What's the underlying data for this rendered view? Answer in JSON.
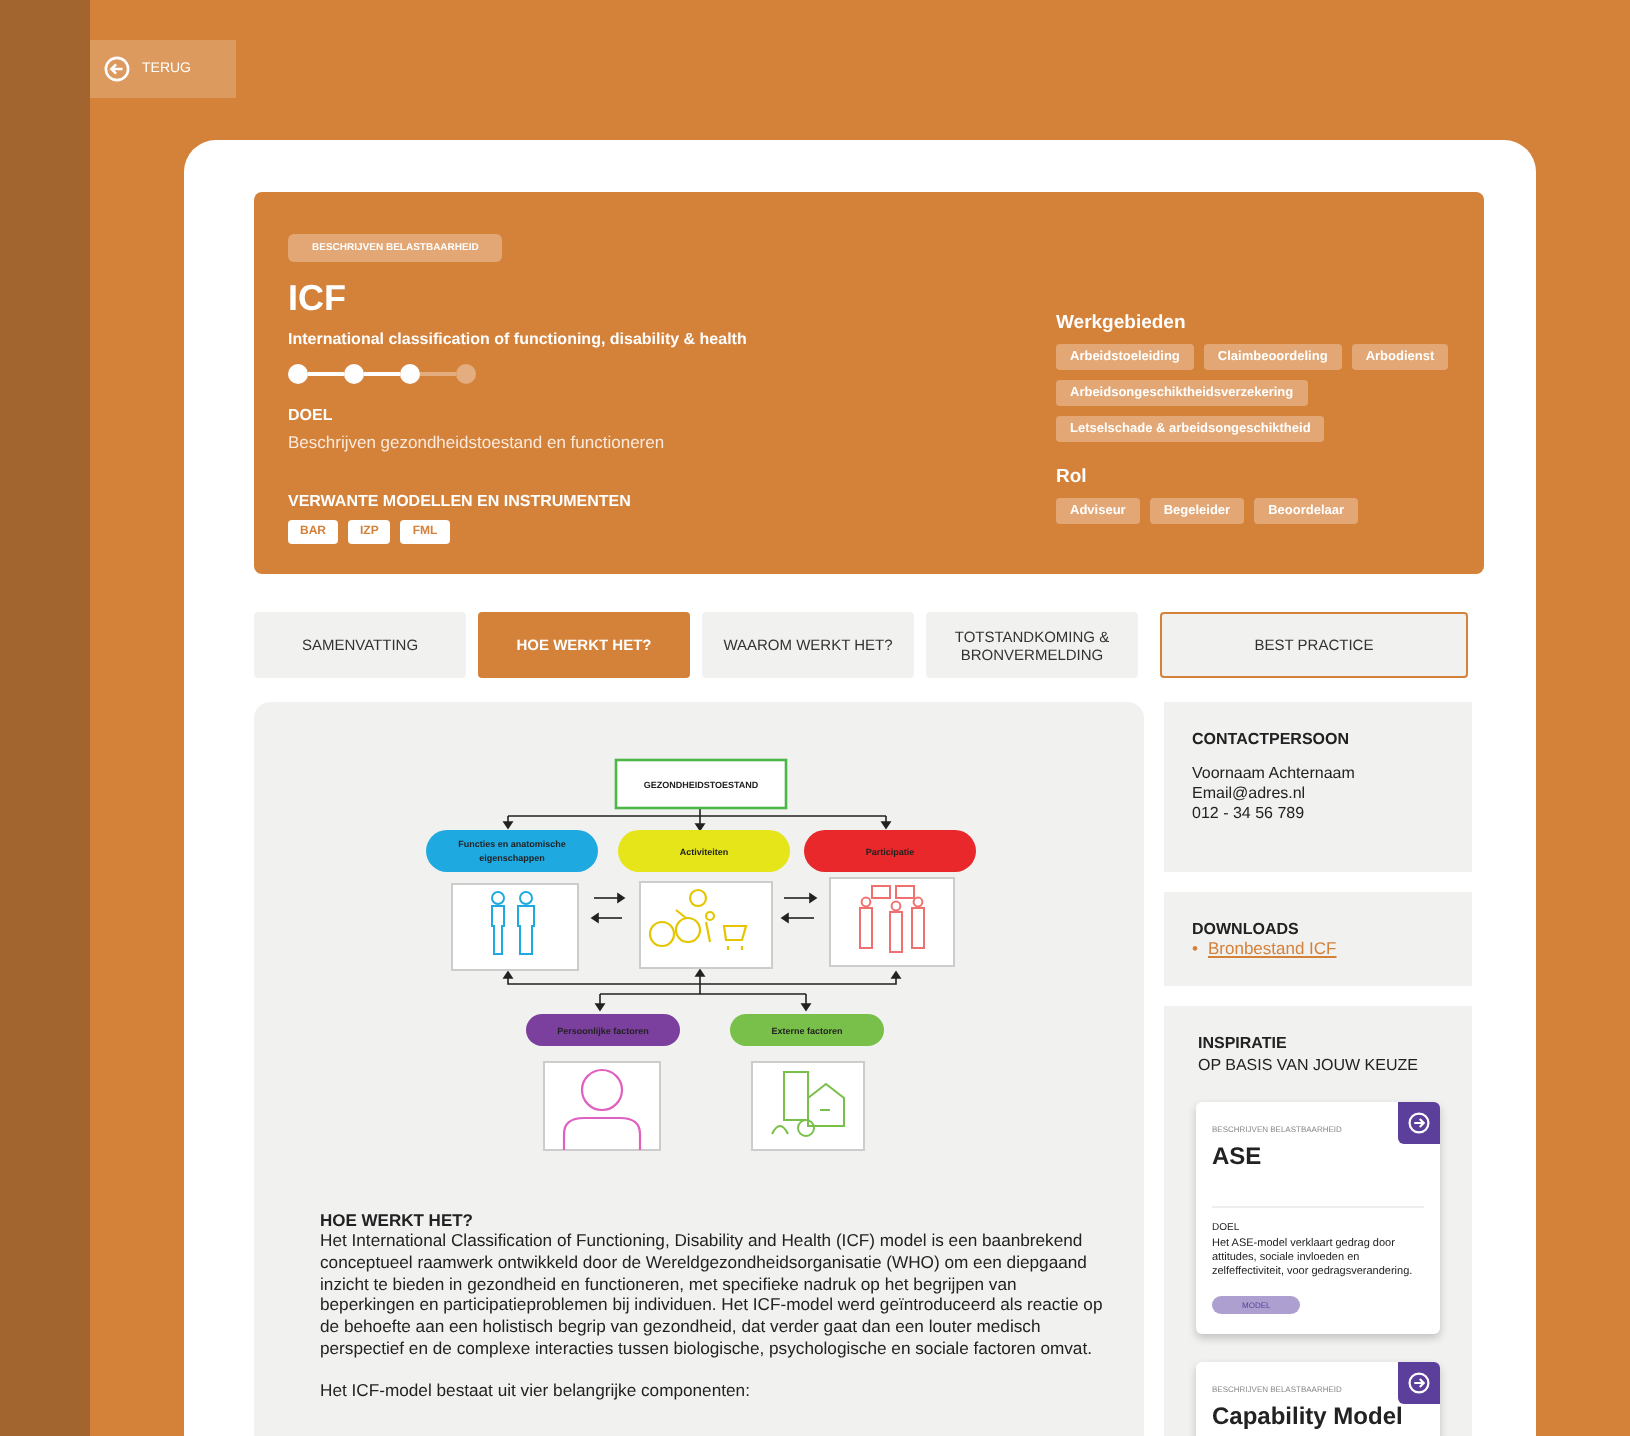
{
  "back_button": {
    "label": "TERUG"
  },
  "header": {
    "category": "BESCHRIJVEN BELASTBAARHEID",
    "title": "ICF",
    "subtitle": "International classification of functioning, disability & health",
    "steps": [
      {
        "on": true
      },
      {
        "on": true
      },
      {
        "on": true
      },
      {
        "on": false
      }
    ],
    "goal_label": "DOEL",
    "goal": "Beschrijven gezondheidstoestand en functioneren",
    "related_label": "VERWANTE MODELLEN EN INSTRUMENTEN",
    "related": [
      "BAR",
      "IZP",
      "FML"
    ],
    "areas_label": "Werkgebieden",
    "areas": [
      "Arbeidstoeleiding",
      "Claimbeoordeling",
      "Arbodienst",
      "Arbeidsongeschiktheidsverzekering",
      "Letselschade & arbeidsongeschiktheid"
    ],
    "role_label": "Rol",
    "roles": [
      "Adviseur",
      "Begeleider",
      "Beoordelaar"
    ]
  },
  "tabs": [
    {
      "label": "SAMENVATTING",
      "selected": false,
      "kind": "tab"
    },
    {
      "label": "HOE WERKT HET?",
      "selected": true,
      "kind": "tab"
    },
    {
      "label": "WAAROM WERKT HET?",
      "selected": false,
      "kind": "tab"
    },
    {
      "label": "TOTSTANDKOMING & BRONVERMELDING",
      "selected": false,
      "kind": "tab"
    },
    {
      "label": "BEST PRACTICE",
      "selected": false,
      "kind": "outlined"
    }
  ],
  "diagram": {
    "state": "GEZONDHEIDSTOESTAND",
    "components": [
      {
        "label": "Functies en anatomische eigenschappen",
        "color": "#1fa9e1"
      },
      {
        "label": "Activiteiten",
        "color": "#e5e51a"
      },
      {
        "label": "Participatie",
        "color": "#e8282b"
      }
    ],
    "factors": [
      {
        "label": "Persoonlijke factoren",
        "color": "#7b3f9e"
      },
      {
        "label": "Externe factoren",
        "color": "#79c04a"
      }
    ]
  },
  "article": {
    "heading": "HOE WERKT HET?",
    "paragraphs": [
      "Het International Classification of Functioning, Disability and Health (ICF) model is een baanbrekend conceptueel raamwerk ontwikkeld door de Wereldgezondheidsorganisatie (WHO) om een diepgaand inzicht te bieden in gezondheid en functioneren, met specifieke nadruk op het begrijpen van beperkingen en participatieproblemen bij individuen. Het ICF-model werd geïntroduceerd als reactie op de behoefte aan een holistisch begrip van gezondheid, dat verder gaat dan een louter medisch perspectief en de complexe interacties tussen biologische, psychologische en sociale factoren omvat.",
      "Het ICF-model bestaat uit vier belangrijke componenten:"
    ]
  },
  "contact": {
    "heading": "CONTACTPERSOON",
    "lines": [
      "Voornaam Achternaam",
      "Email@adres.nl",
      "012 - 34 56 789"
    ]
  },
  "downloads": {
    "heading": "DOWNLOADS",
    "bullet": "•",
    "links": [
      "Bronbestand ICF"
    ]
  },
  "inspiration": {
    "heading": "INSPIRATIE",
    "subheading": "OP BASIS VAN JOUW KEUZE",
    "cards": [
      {
        "category": "BESCHRIJVEN BELASTBAARHEID",
        "title": "ASE",
        "goal_label": "DOEL",
        "goal": "Het ASE-model verklaart gedrag door attitudes, sociale invloeden en zelfeffectiviteit, voor gedragsverandering.",
        "tag": "MODEL"
      },
      {
        "category": "BESCHRIJVEN BELASTBAARHEID",
        "title": "Capability Model"
      }
    ]
  }
}
